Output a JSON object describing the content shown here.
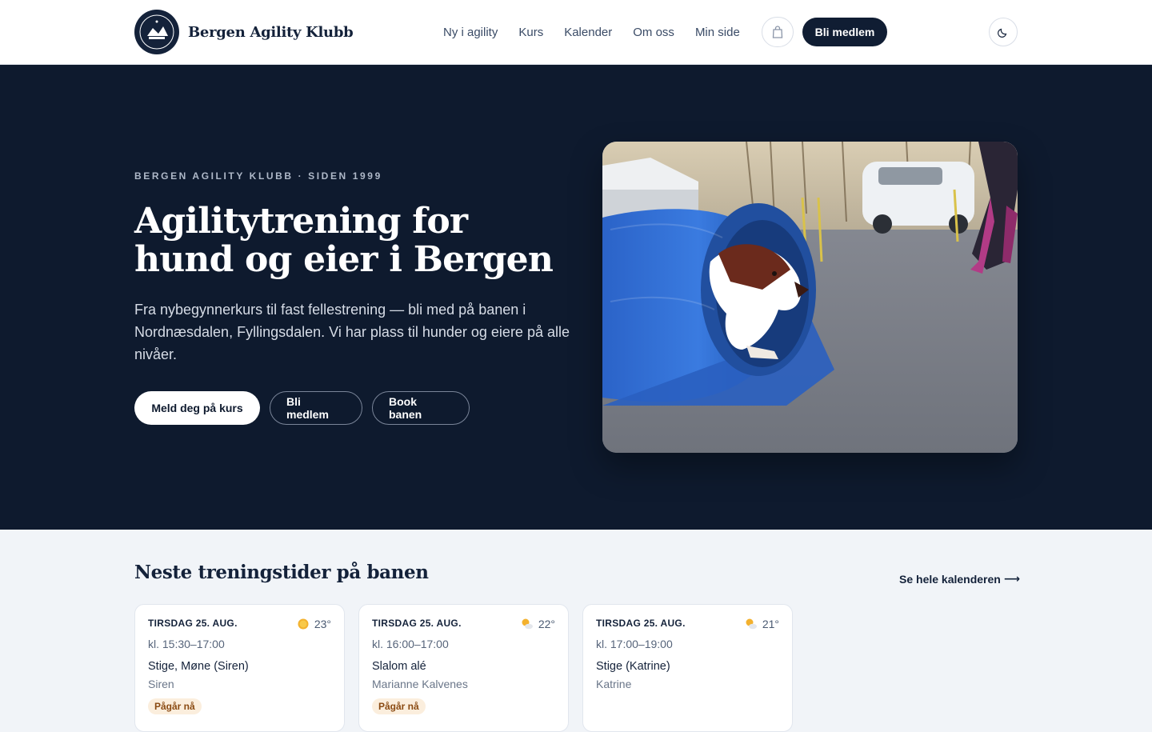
{
  "header": {
    "brand_name": "Bergen Agility Klubb",
    "nav": [
      {
        "label": "Ny i agility"
      },
      {
        "label": "Kurs"
      },
      {
        "label": "Kalender"
      },
      {
        "label": "Om oss"
      },
      {
        "label": "Min side"
      }
    ],
    "cart_icon": "bag-icon",
    "join_label": "Bli medlem",
    "theme_icon": "moon-icon"
  },
  "hero": {
    "eyebrow": "BERGEN AGILITY KLUBB · SIDEN 1999",
    "title_line1": "Agilitytrening for",
    "title_line2": "hund og eier i Bergen",
    "lead": "Fra nybegynnerkurs til fast fellestrening — bli med på banen i Nordnæsdalen, Fyllingsdalen. Vi har plass til hunder og eiere på alle nivåer.",
    "cta_primary": "Meld deg på kurs",
    "cta_member": "Bli medlem",
    "cta_book": "Book banen"
  },
  "sessions": {
    "title": "Neste treningstider på banen",
    "calendar_link": "Se hele kalenderen",
    "cards": [
      {
        "date": "TIRSDAG 25. AUG.",
        "temp": "23°",
        "weather_icon": "sun-icon",
        "time": "kl. 15:30–17:00",
        "title": "Stige, Møne (Siren)",
        "trainer": "Siren",
        "badge": "Pågår nå"
      },
      {
        "date": "TIRSDAG 25. AUG.",
        "temp": "22°",
        "weather_icon": "partly-cloudy-icon",
        "time": "kl. 16:00–17:00",
        "title": "Slalom alé",
        "trainer": "Marianne Kalvenes",
        "badge": "Pågår nå"
      },
      {
        "date": "TIRSDAG 25. AUG.",
        "temp": "21°",
        "weather_icon": "partly-cloudy-icon",
        "time": "kl. 17:00–19:00",
        "title": "Stige (Katrine)",
        "trainer": "Katrine",
        "badge": ""
      }
    ]
  },
  "colors": {
    "navy": "#0e1a2e",
    "button_dark": "#101d33",
    "badge_bg": "#fbeedd",
    "badge_text": "#8a4a12",
    "tunnel_blue": "#2f6fd6"
  }
}
